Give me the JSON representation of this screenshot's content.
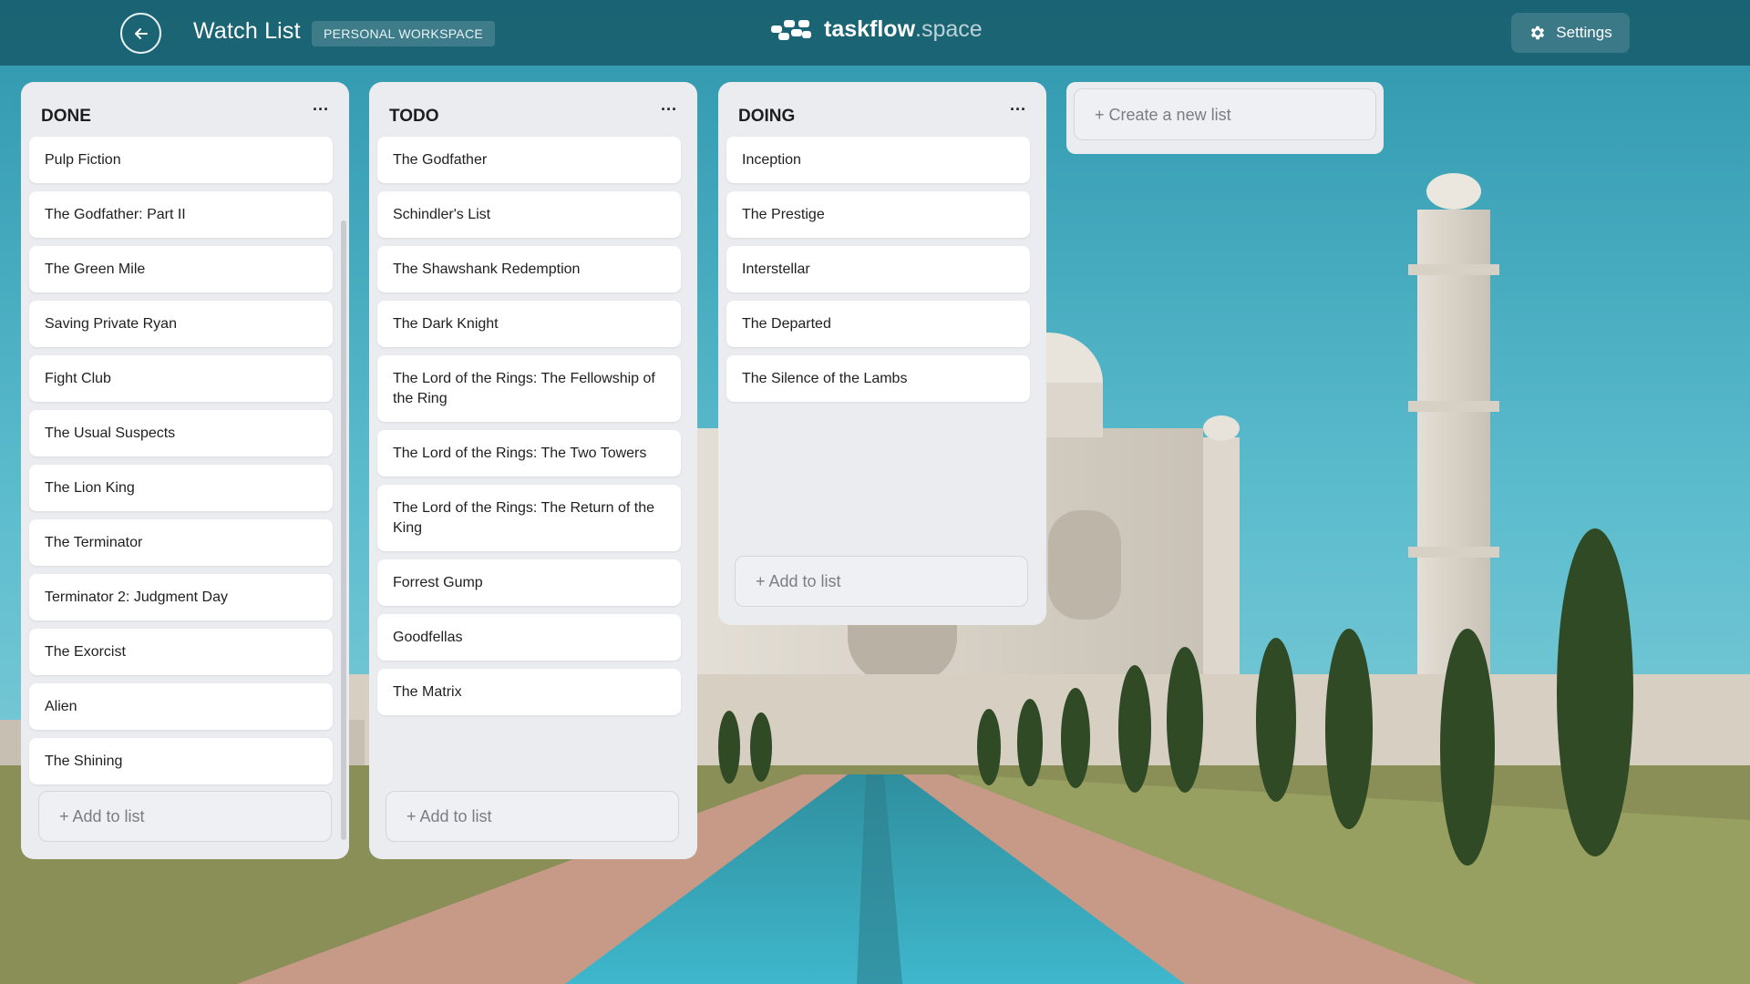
{
  "header": {
    "board_title": "Watch List",
    "workspace_badge": "PERSONAL WORKSPACE",
    "brand_name": "taskflow",
    "brand_tld": ".space",
    "settings_label": "Settings",
    "back_icon": "arrow-left-icon",
    "settings_icon": "gear-icon",
    "brand_icon": "taskflow-logo-icon"
  },
  "lists": [
    {
      "title": "DONE",
      "add_label": "+ Add to list",
      "cards": [
        "Pulp Fiction",
        "The Godfather: Part II",
        "The Green Mile",
        "Saving Private Ryan",
        "Fight Club",
        "The Usual Suspects",
        "The Lion King",
        "The Terminator",
        "Terminator 2: Judgment Day",
        "The Exorcist",
        "Alien",
        "The Shining"
      ]
    },
    {
      "title": "TODO",
      "add_label": "+ Add to list",
      "cards": [
        "The Godfather",
        "Schindler's List",
        "The Shawshank Redemption",
        "The Dark Knight",
        "The Lord of the Rings: The Fellowship of the Ring",
        "The Lord of the Rings: The Two Towers",
        "The Lord of the Rings: The Return of the King",
        "Forrest Gump",
        "Goodfellas",
        "The Matrix"
      ]
    },
    {
      "title": "DOING",
      "add_label": "+ Add to list",
      "cards": [
        "Inception",
        "The Prestige",
        "Interstellar",
        "The Departed",
        "The Silence of the Lambs"
      ]
    }
  ],
  "new_list_label": "+ Create a new list",
  "list_menu_label": "···",
  "colors": {
    "header_bg": "#185c6c",
    "list_bg": "#ebecf0",
    "card_bg": "#ffffff",
    "muted_text": "#7a7d85"
  }
}
